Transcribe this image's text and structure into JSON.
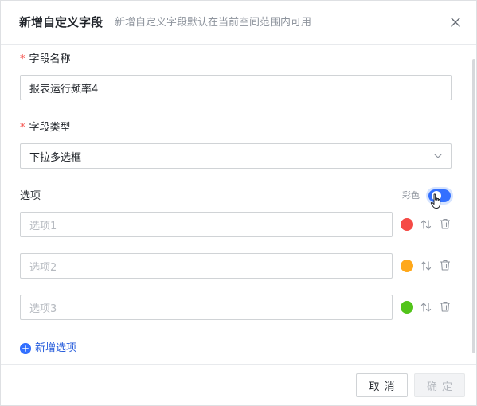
{
  "header": {
    "title": "新增自定义字段",
    "subtitle": "新增自定义字段默认在当前空间范围内可用"
  },
  "form": {
    "name_field": {
      "required_mark": "*",
      "label": "字段名称",
      "value": "报表运行频率4"
    },
    "type_field": {
      "required_mark": "*",
      "label": "字段类型",
      "value": "下拉多选框"
    },
    "options_section": {
      "label": "选项",
      "color_toggle_label": "彩色",
      "color_toggle_on": true,
      "options": [
        {
          "placeholder": "选项1",
          "value": "",
          "color": "#f54a45"
        },
        {
          "placeholder": "选项2",
          "value": "",
          "color": "#ffa81a"
        },
        {
          "placeholder": "选项3",
          "value": "",
          "color": "#52c41a"
        }
      ],
      "add_option_label": "新增选项"
    }
  },
  "footer": {
    "cancel_label": "取消",
    "confirm_label": "确定",
    "confirm_disabled": true
  },
  "icons": {
    "close": "close-icon",
    "select_chevron": "chevron-down-icon",
    "sort": "sort-icon",
    "delete": "trash-icon",
    "add": "plus-circle-icon",
    "pointer": "hand-pointer-icon"
  },
  "colors": {
    "accent": "#3370ff",
    "link": "#245bdb",
    "required": "#f54a45"
  }
}
